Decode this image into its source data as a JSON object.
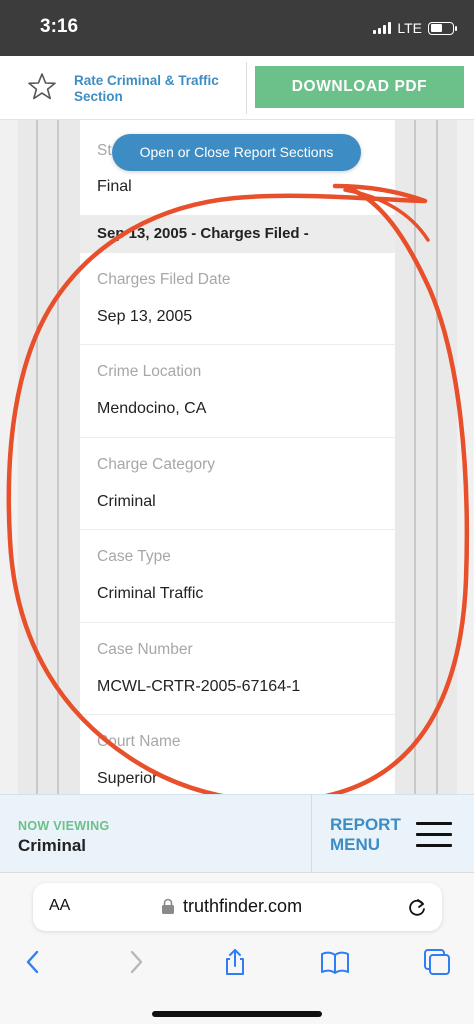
{
  "status": {
    "time": "3:16",
    "network": "LTE"
  },
  "header": {
    "rate_label": "Rate Criminal & Traffic Section",
    "download_label": "DOWNLOAD PDF"
  },
  "floating": {
    "toggle_label": "Open or Close Report Sections"
  },
  "record": {
    "status_label_partial": "St",
    "status_value": "Final",
    "section_heading": "Sep 13, 2005 - Charges Filed -",
    "fields": [
      {
        "label": "Charges Filed Date",
        "value": "Sep 13, 2005"
      },
      {
        "label": "Crime Location",
        "value": "Mendocino, CA"
      },
      {
        "label": "Charge Category",
        "value": "Criminal"
      },
      {
        "label": "Case Type",
        "value": "Criminal Traffic"
      },
      {
        "label": "Case Number",
        "value": "MCWL-CRTR-2005-67164-1"
      },
      {
        "label": "Court Name",
        "value": "Superior"
      }
    ]
  },
  "bottom_bar": {
    "now_viewing_label": "NOW VIEWING",
    "now_viewing_value": "Criminal",
    "report_menu_label": "REPORT MENU"
  },
  "browser": {
    "aa_label": "AA",
    "url": "truthfinder.com"
  },
  "colors": {
    "accent_blue": "#3d8dc4",
    "accent_green": "#6cc08a",
    "annotation_red": "#e8502b",
    "ios_blue": "#2f7ef6"
  },
  "icons": [
    "star-icon",
    "hamburger-icon",
    "lock-icon",
    "reload-icon",
    "back-icon",
    "forward-icon",
    "share-icon",
    "bookmarks-icon",
    "tabs-icon"
  ]
}
